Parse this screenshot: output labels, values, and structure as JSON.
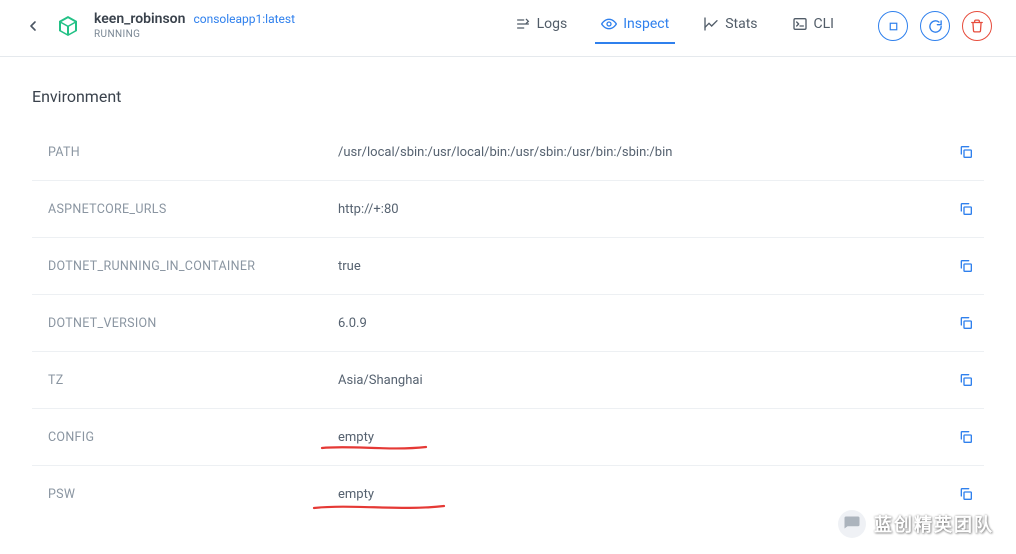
{
  "header": {
    "name": "keen_robinson",
    "image": "consoleapp1:latest",
    "status": "RUNNING"
  },
  "tabs": {
    "logs": "Logs",
    "inspect": "Inspect",
    "stats": "Stats",
    "cli": "CLI"
  },
  "section_title": "Environment",
  "env": [
    {
      "key": "PATH",
      "value": "/usr/local/sbin:/usr/local/bin:/usr/sbin:/usr/bin:/sbin:/bin"
    },
    {
      "key": "ASPNETCORE_URLS",
      "value": "http://+:80"
    },
    {
      "key": "DOTNET_RUNNING_IN_CONTAINER",
      "value": "true"
    },
    {
      "key": "DOTNET_VERSION",
      "value": "6.0.9"
    },
    {
      "key": "TZ",
      "value": "Asia/Shanghai"
    },
    {
      "key": "CONFIG",
      "value": "empty"
    },
    {
      "key": "PSW",
      "value": "empty"
    }
  ],
  "watermark": "蓝创精英团队"
}
